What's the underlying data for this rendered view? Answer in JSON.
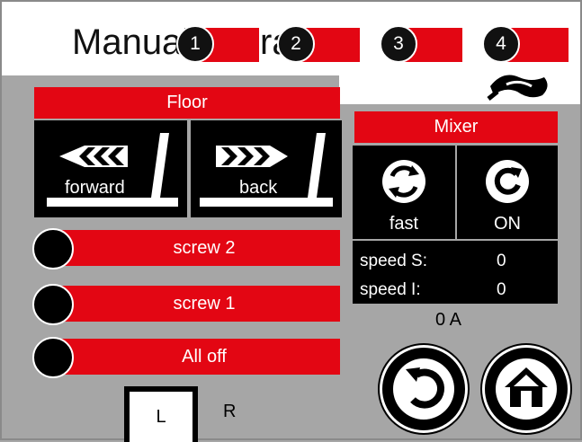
{
  "header": {
    "title": "Manual operation",
    "tabs": [
      {
        "number": "1"
      },
      {
        "number": "2"
      },
      {
        "number": "3"
      },
      {
        "number": "4"
      }
    ]
  },
  "floor": {
    "label": "Floor",
    "forward_label": "forward",
    "back_label": "back"
  },
  "switches": [
    {
      "label": "screw 2"
    },
    {
      "label": "screw 1"
    },
    {
      "label": "All off"
    }
  ],
  "side_selector": {
    "left": "L",
    "right": "R"
  },
  "mixer": {
    "label": "Mixer",
    "fast_label": "fast",
    "on_label": "ON",
    "speed_s_label": "speed S:",
    "speed_s_value": "0",
    "speed_i_label": "speed I:",
    "speed_i_value": "0",
    "current": "0 A"
  },
  "colors": {
    "accent": "#e30613",
    "background": "#a6a6a6",
    "button": "#000000"
  },
  "icons": {
    "back": "undo-arrow-icon",
    "home": "home-icon"
  }
}
